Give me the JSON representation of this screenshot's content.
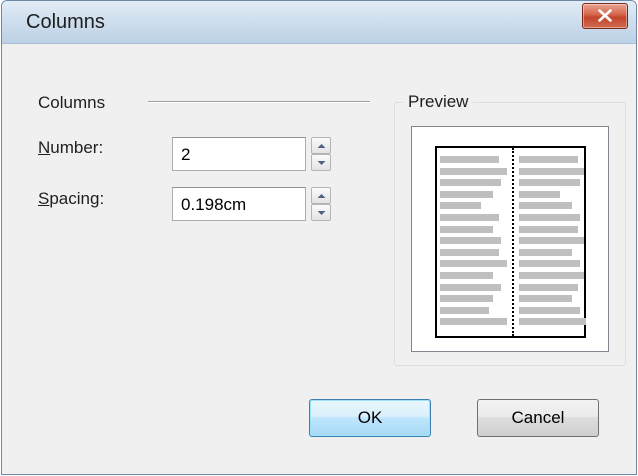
{
  "window": {
    "title": "Columns",
    "close_label": "✕"
  },
  "columns_group": {
    "label": "Columns",
    "number": {
      "label_mnemonic": "N",
      "label_rest": "umber:",
      "value": "2"
    },
    "spacing": {
      "label_mnemonic": "S",
      "label_rest": "pacing:",
      "value": "0.198cm"
    }
  },
  "preview": {
    "label": "Preview",
    "column_count": 2
  },
  "buttons": {
    "ok": "OK",
    "cancel": "Cancel"
  },
  "colors": {
    "dialog_bg": "#f0f0f0",
    "close_button": "#c2452c",
    "default_button": "#bee6fd",
    "preview_lines": "#bfbfbf"
  },
  "icons": {
    "close": "close-icon",
    "spin_up": "spin-up-arrow-icon",
    "spin_down": "spin-down-arrow-icon"
  }
}
